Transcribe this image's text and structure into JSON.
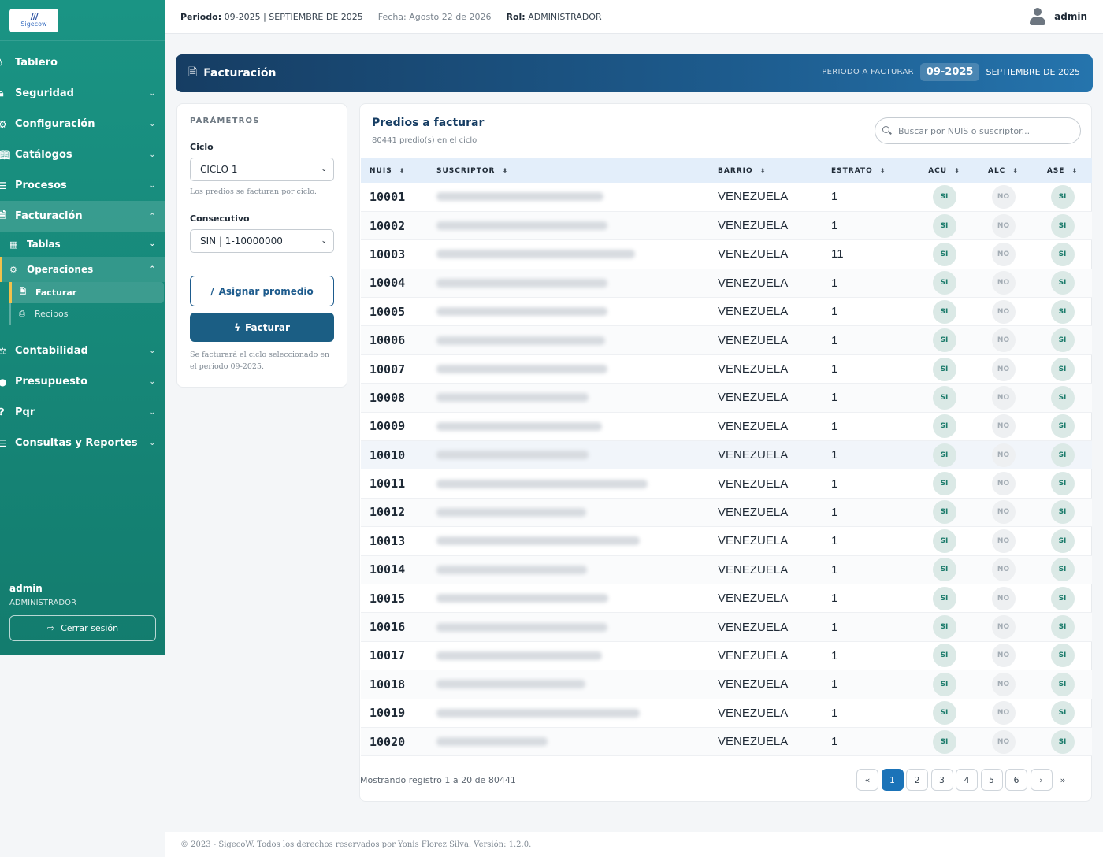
{
  "logo": {
    "text": "Sigecow"
  },
  "sidebar": {
    "items": [
      {
        "label": "Tablero",
        "icon": "drop-icon"
      },
      {
        "label": "Seguridad",
        "icon": "lock-icon"
      },
      {
        "label": "Configuración",
        "icon": "cogs-icon"
      },
      {
        "label": "Catálogos",
        "icon": "book-icon"
      },
      {
        "label": "Procesos",
        "icon": "list-icon"
      },
      {
        "label": "Facturación",
        "icon": "invoice-icon"
      },
      {
        "label": "Contabilidad",
        "icon": "scale-icon"
      },
      {
        "label": "Presupuesto",
        "icon": "piggy-icon"
      },
      {
        "label": "Pqr",
        "icon": "question-icon"
      },
      {
        "label": "Consultas y Reportes",
        "icon": "report-icon"
      }
    ],
    "sub": {
      "tablas": "Tablas",
      "operaciones": "Operaciones",
      "facturar": "Facturar",
      "recibos": "Recibos"
    },
    "user": "admin",
    "role": "ADMINISTRADOR",
    "logout": "Cerrar sesión"
  },
  "topbar": {
    "periodo_label": "Periodo:",
    "periodo_value": "09-2025 | SEPTIEMBRE DE 2025",
    "fecha": "Fecha: Agosto 22 de 2026",
    "rol_label": "Rol:",
    "rol_value": "ADMINISTRADOR",
    "user": "admin"
  },
  "banner": {
    "title": "Facturación",
    "period_label": "PERIODO A FACTURAR",
    "period_code": "09-2025",
    "period_month": "SEPTIEMBRE DE 2025"
  },
  "params": {
    "heading": "PARÁMETROS",
    "ciclo_label": "Ciclo",
    "ciclo_value": "CICLO 1",
    "ciclo_hint": "Los predios se facturan por ciclo.",
    "consecutivo_label": "Consecutivo",
    "consecutivo_value": "SIN | 1-10000000",
    "asignar": "Asignar promedio",
    "facturar": "Facturar",
    "footer_hint": "Se facturará el ciclo seleccionado en el periodo 09-2025."
  },
  "table": {
    "title": "Predios a facturar",
    "subtitle": "80441 predio(s) en el ciclo",
    "search_placeholder": "Buscar por NUIS o suscriptor...",
    "columns": [
      "NUIS",
      "SUSCRIPTOR",
      "BARRIO",
      "ESTRATO",
      "ACU",
      "ALC",
      "ASE"
    ],
    "rows": [
      {
        "nuis": "10001",
        "barrio": "VENEZUELA",
        "estrato": "1",
        "acu": "SI",
        "alc": "NO",
        "ase": "SI"
      },
      {
        "nuis": "10002",
        "barrio": "VENEZUELA",
        "estrato": "1",
        "acu": "SI",
        "alc": "NO",
        "ase": "SI"
      },
      {
        "nuis": "10003",
        "barrio": "VENEZUELA",
        "estrato": "11",
        "acu": "SI",
        "alc": "NO",
        "ase": "SI"
      },
      {
        "nuis": "10004",
        "barrio": "VENEZUELA",
        "estrato": "1",
        "acu": "SI",
        "alc": "NO",
        "ase": "SI"
      },
      {
        "nuis": "10005",
        "barrio": "VENEZUELA",
        "estrato": "1",
        "acu": "SI",
        "alc": "NO",
        "ase": "SI"
      },
      {
        "nuis": "10006",
        "barrio": "VENEZUELA",
        "estrato": "1",
        "acu": "SI",
        "alc": "NO",
        "ase": "SI"
      },
      {
        "nuis": "10007",
        "barrio": "VENEZUELA",
        "estrato": "1",
        "acu": "SI",
        "alc": "NO",
        "ase": "SI"
      },
      {
        "nuis": "10008",
        "barrio": "VENEZUELA",
        "estrato": "1",
        "acu": "SI",
        "alc": "NO",
        "ase": "SI"
      },
      {
        "nuis": "10009",
        "barrio": "VENEZUELA",
        "estrato": "1",
        "acu": "SI",
        "alc": "NO",
        "ase": "SI"
      },
      {
        "nuis": "10010",
        "barrio": "VENEZUELA",
        "estrato": "1",
        "acu": "SI",
        "alc": "NO",
        "ase": "SI"
      },
      {
        "nuis": "10011",
        "barrio": "VENEZUELA",
        "estrato": "1",
        "acu": "SI",
        "alc": "NO",
        "ase": "SI"
      },
      {
        "nuis": "10012",
        "barrio": "VENEZUELA",
        "estrato": "1",
        "acu": "SI",
        "alc": "NO",
        "ase": "SI"
      },
      {
        "nuis": "10013",
        "barrio": "VENEZUELA",
        "estrato": "1",
        "acu": "SI",
        "alc": "NO",
        "ase": "SI"
      },
      {
        "nuis": "10014",
        "barrio": "VENEZUELA",
        "estrato": "1",
        "acu": "SI",
        "alc": "NO",
        "ase": "SI"
      },
      {
        "nuis": "10015",
        "barrio": "VENEZUELA",
        "estrato": "1",
        "acu": "SI",
        "alc": "NO",
        "ase": "SI"
      },
      {
        "nuis": "10016",
        "barrio": "VENEZUELA",
        "estrato": "1",
        "acu": "SI",
        "alc": "NO",
        "ase": "SI"
      },
      {
        "nuis": "10017",
        "barrio": "VENEZUELA",
        "estrato": "1",
        "acu": "SI",
        "alc": "NO",
        "ase": "SI"
      },
      {
        "nuis": "10018",
        "barrio": "VENEZUELA",
        "estrato": "1",
        "acu": "SI",
        "alc": "NO",
        "ase": "SI"
      },
      {
        "nuis": "10019",
        "barrio": "VENEZUELA",
        "estrato": "1",
        "acu": "SI",
        "alc": "NO",
        "ase": "SI"
      },
      {
        "nuis": "10020",
        "barrio": "VENEZUELA",
        "estrato": "1",
        "acu": "SI",
        "alc": "NO",
        "ase": "SI"
      }
    ],
    "footer_info": "Mostrando registro 1 a 20 de 80441",
    "pages": [
      "1",
      "2",
      "3",
      "4",
      "5",
      "6"
    ],
    "pager_first": "«",
    "pager_next": "›",
    "pager_last": "»"
  },
  "copyright": "© 2023 - SigecoW. Todos los derechos reservados por Yonis Florez Silva. Versión: 1.2.0.",
  "colors": {
    "sidebar": "#1a9484",
    "primary": "#1d5b8d",
    "accent": "#f3c14b",
    "active_page": "#1b73b8"
  }
}
